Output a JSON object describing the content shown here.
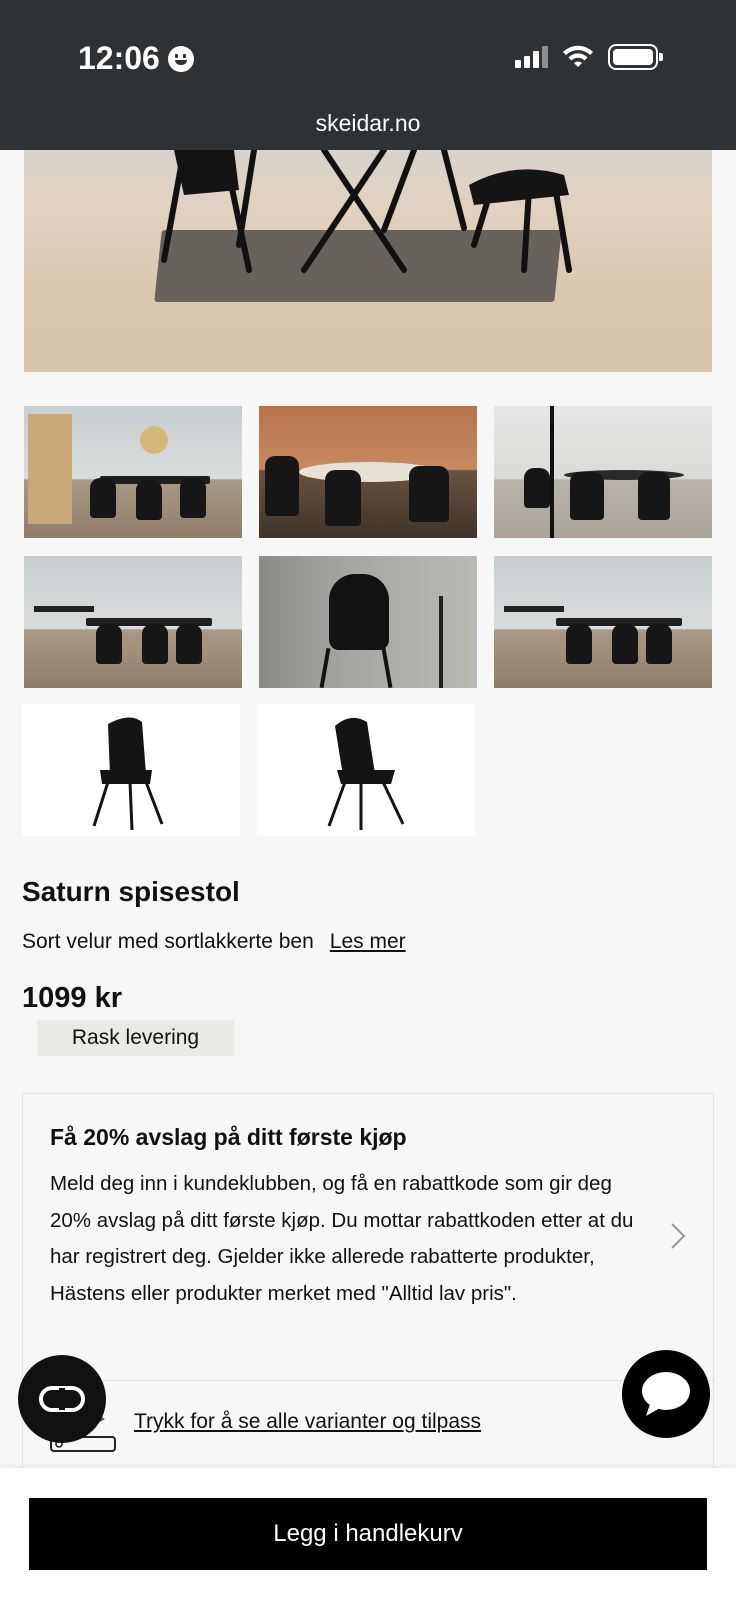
{
  "status_bar": {
    "time": "12:06",
    "url": "skeidar.no",
    "icons": [
      "smiley-icon",
      "cellular-signal-icon",
      "wifi-icon",
      "battery-icon"
    ]
  },
  "product": {
    "title": "Saturn spisestol",
    "description": "Sort velur med sortlakkerte ben",
    "read_more": "Les mer",
    "price": "1099 kr",
    "badge": "Rask levering"
  },
  "gallery": {
    "thumbnails": [
      "dining-room-scene",
      "dining-table-warm-wall",
      "dining-table-bright-room",
      "dining-room-console",
      "chair-closeup",
      "dining-room-console-2",
      "chair-front-white",
      "chair-side-white"
    ]
  },
  "promo": {
    "title": "Få 20% avslag på ditt første kjøp",
    "text": "Meld deg inn i kundeklubben, og få en rabattkode som gir deg 20% avslag på ditt første kjøp. Du mottar rabattkoden etter at du har registrert deg. Gjelder ikke allerede rabatterte produkter, Hästens eller produkter merket med \"Alltid lav pris\".",
    "variants_link": "Trykk for å se alle varianter og tilpass"
  },
  "actions": {
    "add_to_cart": "Legg i handlekurv"
  },
  "colors": {
    "topbar": "#2f3235",
    "button": "#000000",
    "badge_bg": "#ebe9e4",
    "page_bg": "#f7f7f7"
  }
}
